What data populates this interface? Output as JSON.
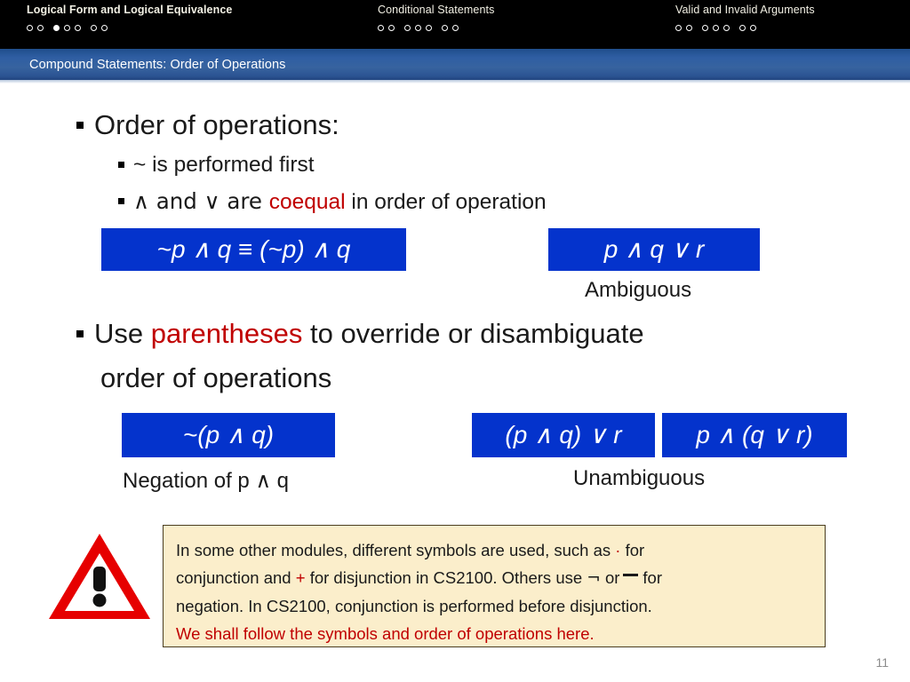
{
  "header": {
    "sections": [
      {
        "title": "Logical Form and Logical Equivalence",
        "dots_total": 7,
        "active_index": 2
      },
      {
        "title": "Conditional Statements",
        "dots_total": 7,
        "active_index": -1
      },
      {
        "title": "Valid and Invalid Arguments",
        "dots_total": 7,
        "active_index": -1
      }
    ]
  },
  "slide": {
    "title": "Compound Statements: Order of Operations",
    "page_number": "11",
    "bullets": {
      "b1": "Order of operations:",
      "b1_sub1": "~ is performed first",
      "b1_sub2_pre": "∧ and ∨ are ",
      "b1_sub2_hl": "coequal",
      "b1_sub2_post": " in order of operation",
      "b2_pre": "Use ",
      "b2_hl": "parentheses",
      "b2_post": " to override or disambiguate",
      "b2_line2": "order of operations"
    },
    "formulas": {
      "f1": "~p ∧ q ≡ (~p) ∧ q",
      "f2": "p ∧ q ∨ r",
      "f2_caption": "Ambiguous",
      "f3": "~(p ∧ q)",
      "f3_caption": "Negation of p ∧ q",
      "f4": "(p ∧ q) ∨ r",
      "f5": "p ∧ (q ∨ r)",
      "f45_caption": "Unambiguous"
    },
    "note": {
      "line1_a": "In some other modules, different symbols are used, such as ",
      "line1_sym": "·",
      "line1_b": " for",
      "line2_a": "conjunction and ",
      "line2_sym": "+",
      "line2_b": " for disjunction in CS2100. Others use ",
      "line2_sym2": "¬",
      "line2_c": " or",
      "line2_d": "for",
      "line3": "negation. In CS2100, conjunction is performed before disjunction.",
      "line4": "We shall follow the symbols and order of operations here."
    }
  },
  "colors": {
    "accent_blue": "#0433CC",
    "title_bar_blue": "#2f5ea3",
    "highlight_red": "#c00000",
    "note_background": "#fbeecb",
    "note_border": "#4a3d20"
  }
}
